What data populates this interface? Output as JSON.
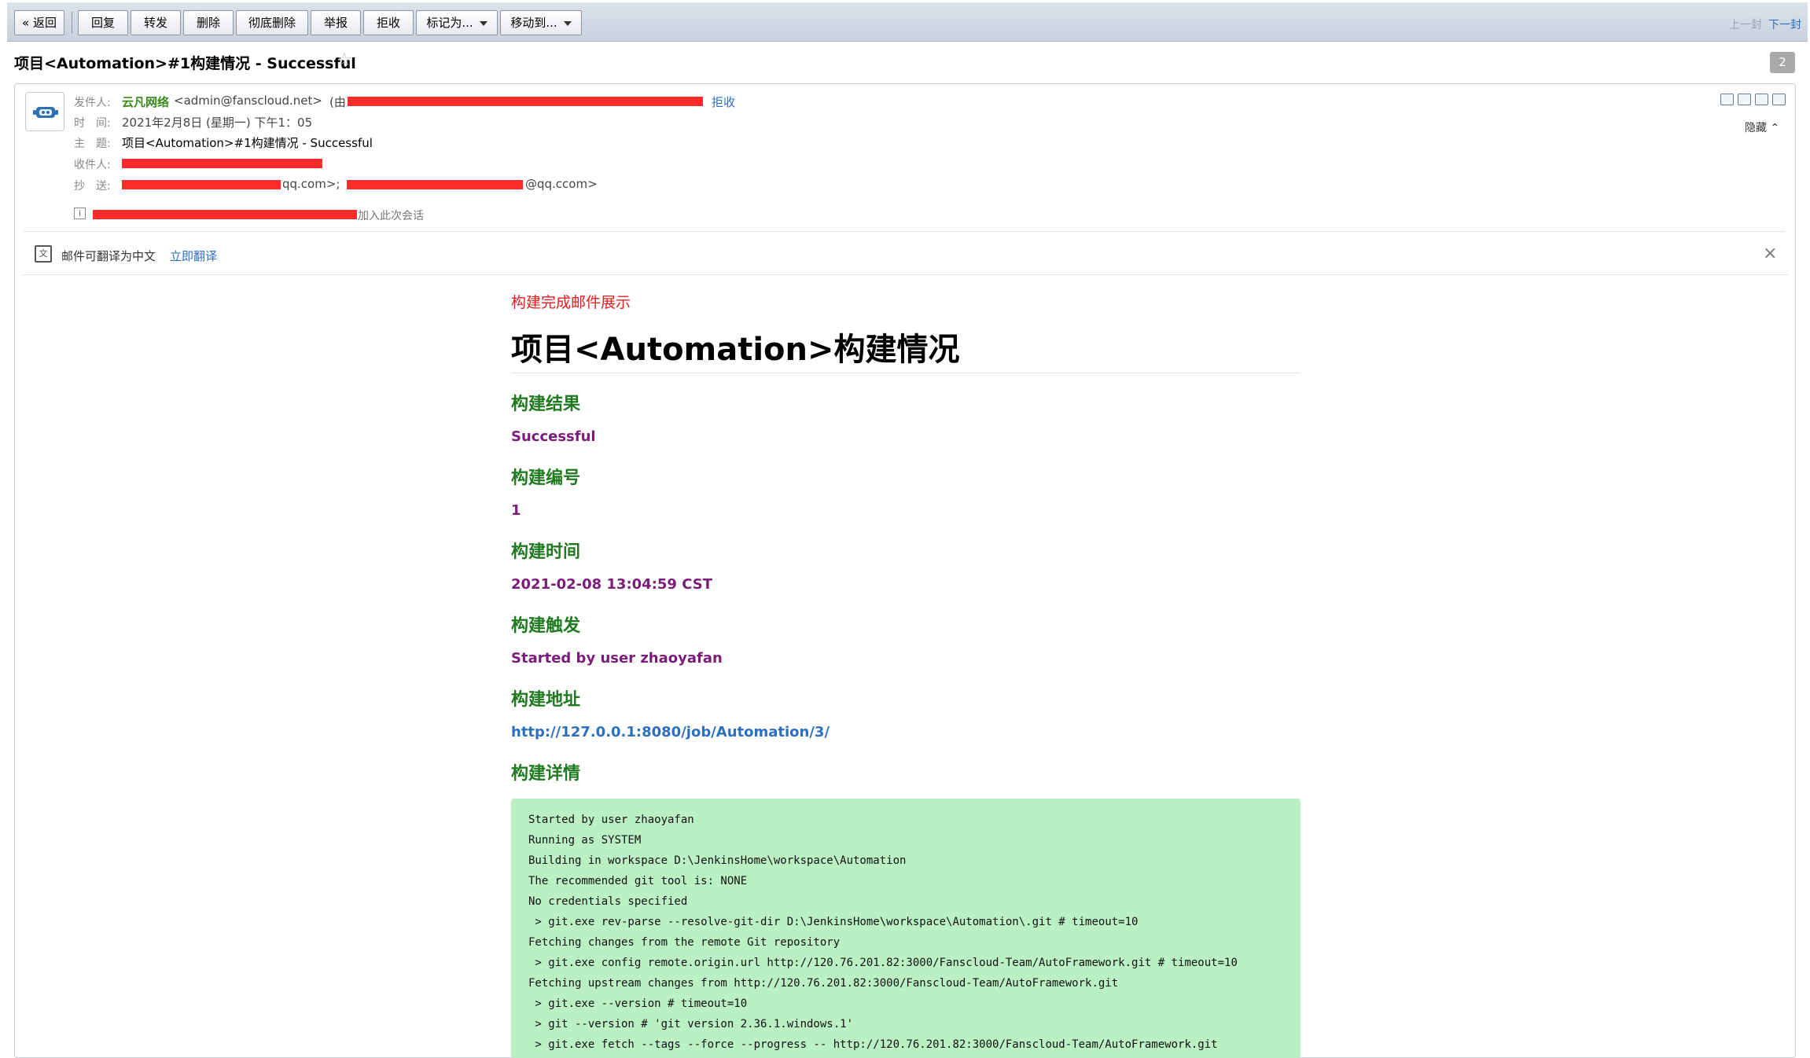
{
  "toolbar": {
    "back_label": "« 返回",
    "reply_label": "回复",
    "forward_label": "转发",
    "delete_label": "删除",
    "perm_delete_label": "彻底删除",
    "report_label": "举报",
    "reject_label": "拒收",
    "mark_as_label": "标记为...",
    "move_to_label": "移动到...",
    "prev_label": "上一封",
    "next_label": "下一封"
  },
  "message": {
    "subject": "项目<Automation>#1构建情况 - Successful",
    "count_badge": "2"
  },
  "header": {
    "from_label": "发件人:",
    "from_name": "云凡网络",
    "from_email": "<admin@fanscloud.net>",
    "from_prefix": "(由",
    "reject_link": "拒收",
    "time_label": "时　间:",
    "time_value": "2021年2月8日 (星期一) 下午1：05",
    "subject_label": "主　题:",
    "subject_value": "项目<Automation>#1构建情况 - Successful",
    "to_label": "收件人:",
    "cc_label": "抄　送:",
    "cc_value_1": "qq.com>;",
    "cc_value_2": "@qq.ccom>",
    "join_text": "加入此次会话",
    "hide_link": "隐藏 ⌃"
  },
  "translate": {
    "text": "邮件可翻译为中文",
    "link": "立即翻译",
    "close": "×"
  },
  "content": {
    "intro": "构建完成邮件展示",
    "title": "项目<Automation>构建情况",
    "result_heading": "构建结果",
    "result_value": "Successful",
    "number_heading": "构建编号",
    "number_value": "1",
    "time_heading": "构建时间",
    "time_value": "2021-02-08 13:04:59 CST",
    "trigger_heading": "构建触发",
    "trigger_value": "Started by user zhaoyafan",
    "url_heading": "构建地址",
    "url_value": "http://127.0.0.1:8080/job/Automation/3/",
    "detail_heading": "构建详情",
    "console_lines": [
      "Started by user zhaoyafan",
      "Running as SYSTEM",
      "Building in workspace D:\\JenkinsHome\\workspace\\Automation",
      "The recommended git tool is: NONE",
      "No credentials specified",
      " > git.exe rev-parse --resolve-git-dir D:\\JenkinsHome\\workspace\\Automation\\.git # timeout=10",
      "Fetching changes from the remote Git repository",
      " > git.exe config remote.origin.url http://120.76.201.82:3000/Fanscloud-Team/AutoFramework.git # timeout=10",
      "Fetching upstream changes from http://120.76.201.82:3000/Fanscloud-Team/AutoFramework.git",
      " > git.exe --version # timeout=10",
      " > git --version # 'git version 2.36.1.windows.1'",
      " > git.exe fetch --tags --force --progress -- http://120.76.201.82:3000/Fanscloud-Team/AutoFramework.git"
    ]
  },
  "colors": {
    "heading_green": "#1f7a1f",
    "value_purple": "#7b1b7b",
    "intro_red": "#e02020",
    "link_blue": "#2d6fbf",
    "console_bg": "#baf0c4",
    "redaction_red": "#ff2b2b"
  }
}
